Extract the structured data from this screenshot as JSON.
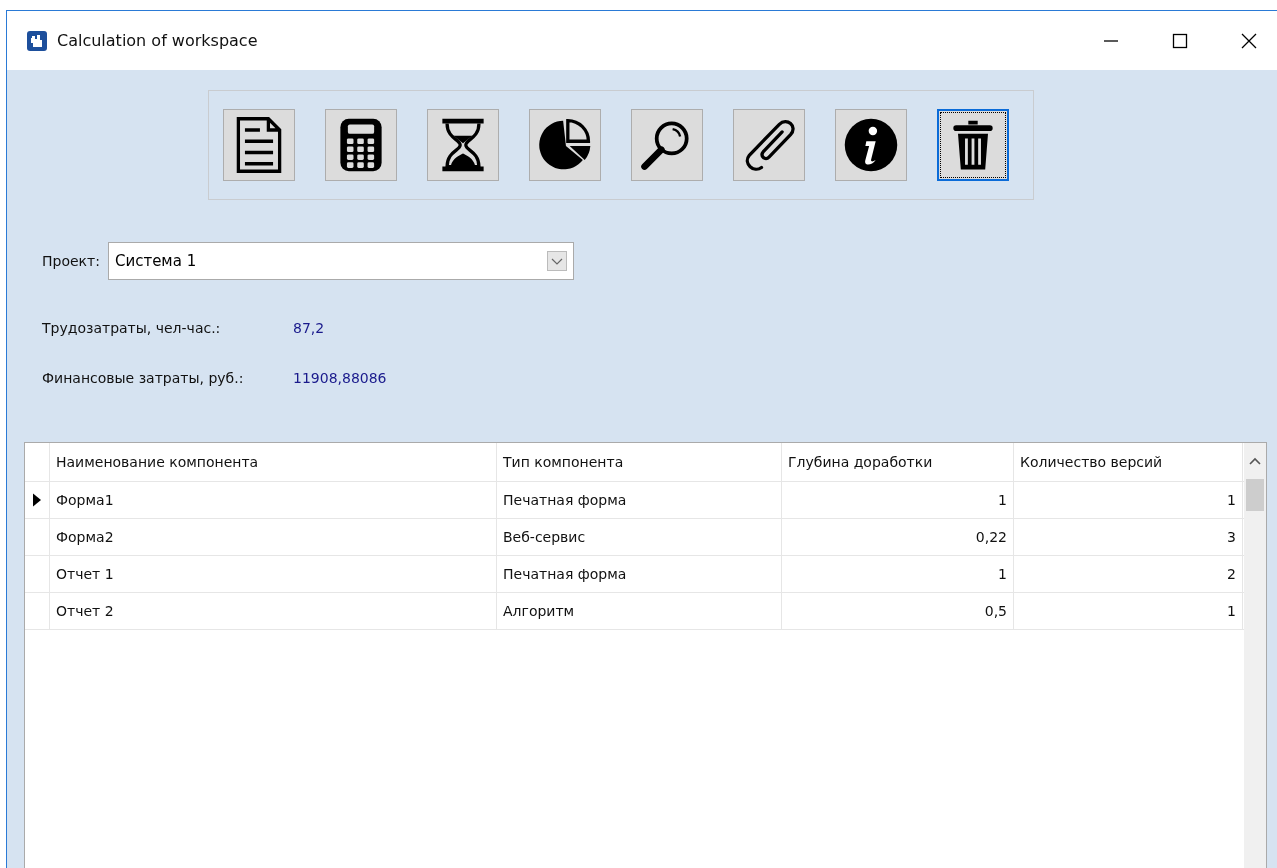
{
  "window": {
    "title": "Calculation of workspace"
  },
  "toolbar": [
    {
      "kind": "document",
      "focused": false
    },
    {
      "kind": "calculator",
      "focused": false
    },
    {
      "kind": "hourglass",
      "focused": false
    },
    {
      "kind": "chart",
      "focused": false
    },
    {
      "kind": "search",
      "focused": false
    },
    {
      "kind": "attach",
      "focused": false
    },
    {
      "kind": "info",
      "focused": false
    },
    {
      "kind": "delete",
      "focused": true
    }
  ],
  "project": {
    "label": "Проект:",
    "value": "Система 1"
  },
  "stats": [
    {
      "label": "Трудозатраты, чел-час.:",
      "value": "87,2"
    },
    {
      "label": "Финансовые затраты, руб.:",
      "value": "11908,88086"
    }
  ],
  "table": {
    "columns": [
      "Наименование компонента",
      "Тип компонента",
      "Глубина доработки",
      "Количество версий"
    ],
    "rows": [
      {
        "selected": true,
        "cells": [
          "Форма1",
          "Печатная форма",
          "1",
          "1"
        ]
      },
      {
        "selected": false,
        "cells": [
          "Форма2",
          "Веб-сервис",
          "0,22",
          "3"
        ]
      },
      {
        "selected": false,
        "cells": [
          "Отчет 1",
          "Печатная форма",
          "1",
          "2"
        ]
      },
      {
        "selected": false,
        "cells": [
          "Отчет 2",
          "Алгоритм",
          "0,5",
          "1"
        ]
      }
    ]
  }
}
